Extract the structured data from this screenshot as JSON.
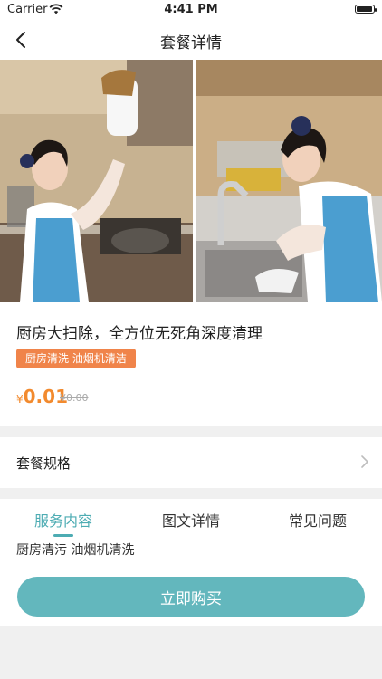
{
  "status_bar": {
    "carrier": "Carrier",
    "time": "4:41 PM",
    "battery_level": 0.95
  },
  "nav": {
    "title": "套餐详情",
    "back_icon": "chevron-left-icon"
  },
  "hero": {
    "image_description": "cleaning worker"
  },
  "product": {
    "title": "厨房大扫除，全方位无死角深度清理",
    "tags": "厨房清洗 油烟机清洁",
    "price_currency": "¥",
    "price_amount": "0.01",
    "original_price": "¥0.00"
  },
  "spec": {
    "label": "套餐规格",
    "icon": "chevron-right-icon"
  },
  "tabs": [
    {
      "label": "服务内容",
      "active": true
    },
    {
      "label": "图文详情",
      "active": false
    },
    {
      "label": "常见问题",
      "active": false
    }
  ],
  "service_content": "厨房清污 油烟机清洗",
  "buy_button": {
    "label": "立即购买"
  },
  "colors": {
    "accent": "#63b7bd",
    "tab_active": "#4dacb3",
    "tag_bg": "#f0844a",
    "price": "#f28a2e"
  }
}
